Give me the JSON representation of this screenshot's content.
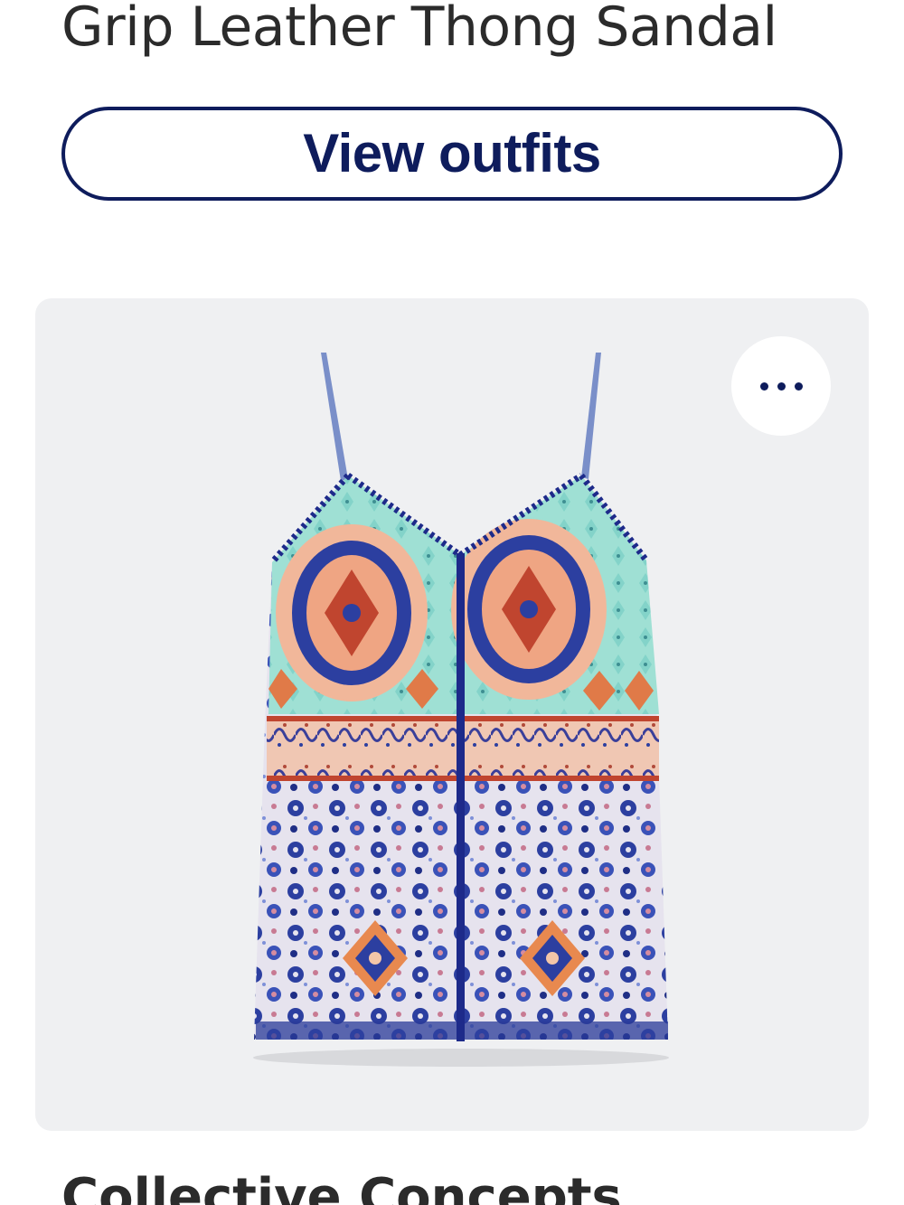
{
  "product": {
    "title": "Grip Leather Thong Sandal"
  },
  "actions": {
    "view_outfits_label": "View outfits",
    "more_icon": "more-horizontal-icon"
  },
  "next_item": {
    "brand": "Collective Concepts"
  },
  "colors": {
    "brand_navy": "#0e1c5c",
    "card_background": "#eff0f2",
    "text_dark": "#2b2b2b"
  }
}
